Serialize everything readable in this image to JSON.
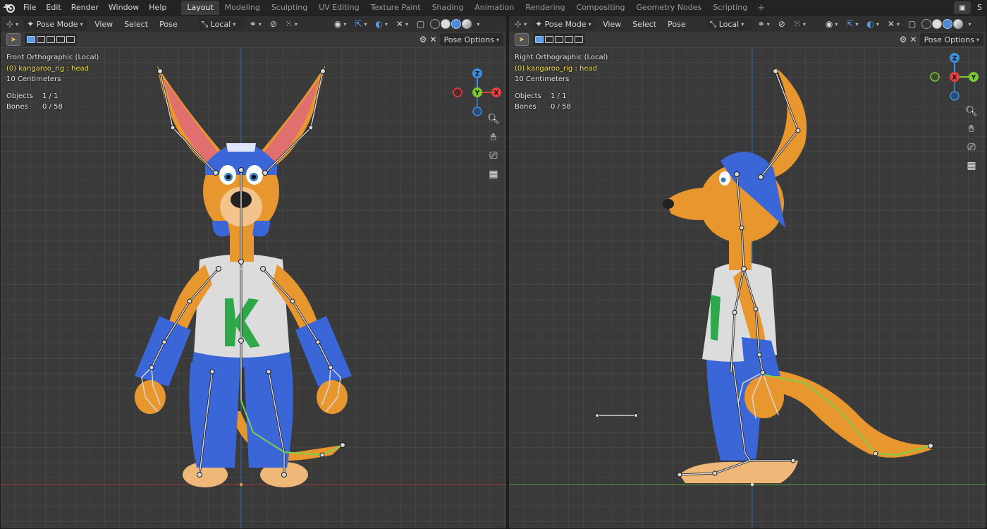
{
  "app": {
    "menus": [
      "File",
      "Edit",
      "Render",
      "Window",
      "Help"
    ],
    "workspaces": [
      "Layout",
      "Modeling",
      "Sculpting",
      "UV Editing",
      "Texture Paint",
      "Shading",
      "Animation",
      "Rendering",
      "Compositing",
      "Geometry Nodes",
      "Scripting"
    ],
    "active_workspace": "Layout",
    "scene_initial": "S"
  },
  "viewport_left": {
    "mode": "Pose Mode",
    "menus": [
      "View",
      "Select",
      "Pose"
    ],
    "transform_orientation": "Local",
    "pose_options": "Pose Options",
    "view_name": "Front Orthographic (Local)",
    "active_object": "(0) kangaroo_rig : head",
    "scale": "10 Centimeters",
    "objects_label": "Objects",
    "objects_value": "1 / 1",
    "bones_label": "Bones",
    "bones_value": "0 / 58",
    "gizmo_axes": [
      "Z",
      "Y",
      "X"
    ]
  },
  "viewport_right": {
    "mode": "Pose Mode",
    "menus": [
      "View",
      "Select",
      "Pose"
    ],
    "transform_orientation": "Local",
    "pose_options": "Pose Options",
    "view_name": "Right Orthographic (Local)",
    "active_object": "(0) kangaroo_rig : head",
    "scale": "10 Centimeters",
    "objects_label": "Objects",
    "objects_value": "1 / 1",
    "bones_label": "Bones",
    "bones_value": "0 / 58",
    "gizmo_axes": [
      "Z",
      "X",
      "Y"
    ]
  },
  "colors": {
    "accent": "#5c9ce6",
    "active_object_text": "#f0e040",
    "x_axis": "#e8403f",
    "y_axis": "#7bc930",
    "z_axis": "#3a8fe0",
    "kangaroo_fur": "#e8962e",
    "cap_and_pants": "#3a66d8",
    "shirt": "#dcdcdc",
    "shirt_logo": "#2ea84a"
  },
  "icons": {
    "blender_logo": "blender-logo-icon",
    "zoom": "zoom-icon",
    "pan": "hand-icon",
    "camera": "camera-icon",
    "ortho": "grid-icon"
  }
}
